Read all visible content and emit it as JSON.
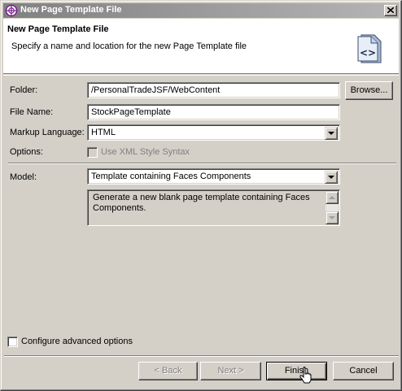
{
  "window": {
    "title": "New Page Template File"
  },
  "banner": {
    "title": "New Page Template File",
    "description": "Specify a name and location for the new Page Template file",
    "icon": "page-template-icon"
  },
  "form": {
    "folder": {
      "label": "Folder:",
      "value": "/PersonalTradeJSF/WebContent",
      "browse_label": "Browse..."
    },
    "file_name": {
      "label": "File Name:",
      "value": "StockPageTemplate"
    },
    "markup_language": {
      "label": "Markup Language:",
      "value": "HTML"
    },
    "options": {
      "label": "Options:",
      "xml_style_label": "Use XML Style Syntax",
      "xml_style_checked": false,
      "xml_style_enabled": false
    },
    "model": {
      "label": "Model:",
      "value": "Template containing Faces Components",
      "description": "Generate a new blank page template containing Faces Components."
    }
  },
  "advanced": {
    "label": "Configure advanced options",
    "checked": false
  },
  "buttons": {
    "back": "< Back",
    "next": "Next >",
    "finish": "Finish",
    "cancel": "Cancel"
  },
  "colors": {
    "dialog_background": "#d4d0c8",
    "title_bar_start": "#808080",
    "title_bar_end": "#b5b5b5",
    "banner_background": "#ffffff",
    "disabled_text": "#808080"
  }
}
